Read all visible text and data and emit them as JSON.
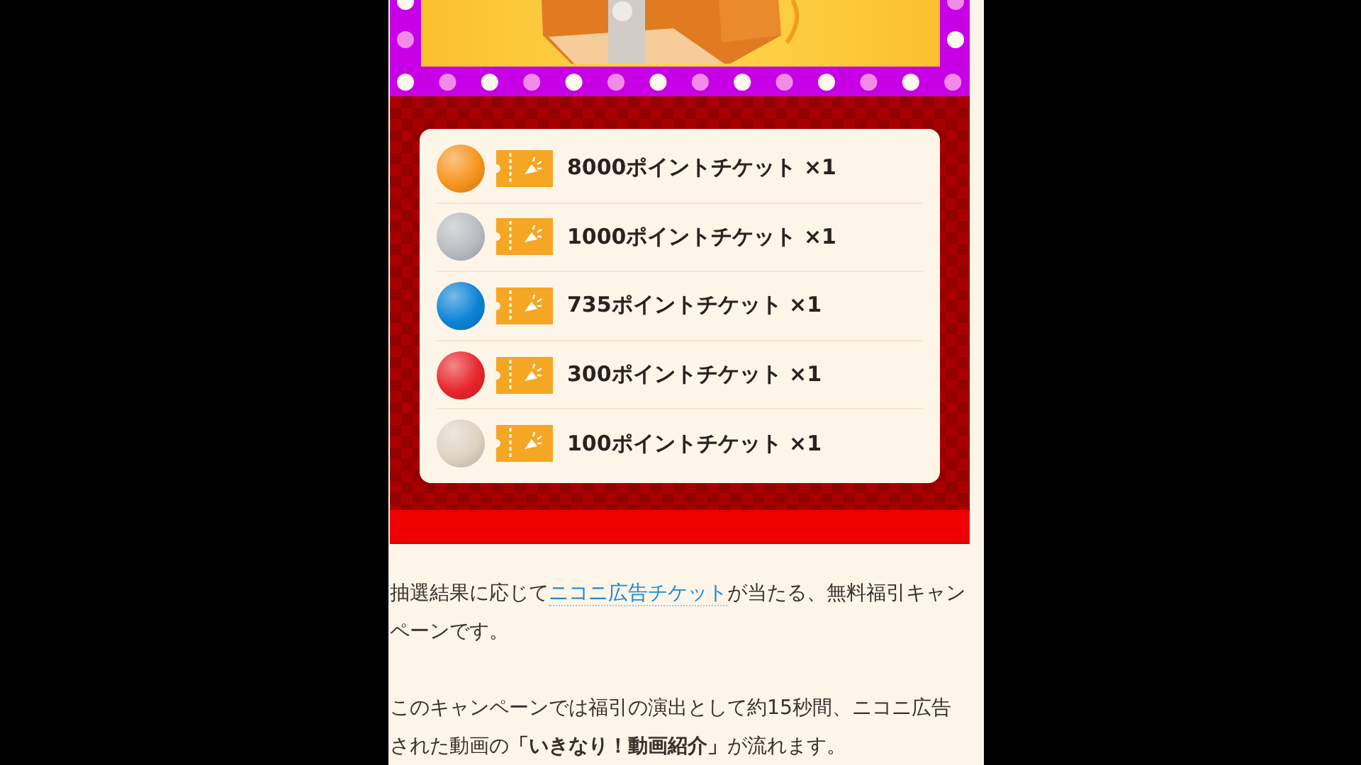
{
  "prizes": [
    {
      "label": "8000ポイントチケット ×1",
      "color": "#f7941d"
    },
    {
      "label": "1000ポイントチケット ×1",
      "color": "#b9bcc2"
    },
    {
      "label": "735ポイントチケット ×1",
      "color": "#0b84d6"
    },
    {
      "label": "300ポイントチケット ×1",
      "color": "#e8262b"
    },
    {
      "label": "100ポイントチケット ×1",
      "color": "#ddd3c1"
    }
  ],
  "intro": {
    "before": "抽選結果に応じて",
    "link": "ニコニ広告チケット",
    "after": "が当たる、無料福引キャンペーンです。"
  },
  "note": "このキャンペーンでは福引の演出として約15秒間、ニコニ広告された動画の**「いきなり！動画紹介」**が流れます。"
}
